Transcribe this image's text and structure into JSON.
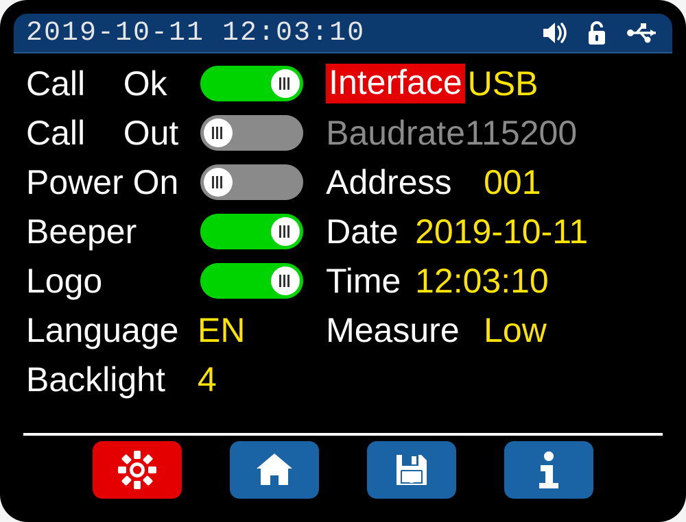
{
  "status": {
    "datetime": "2019-10-11 12:03:10"
  },
  "left": {
    "call_ok_label": "Call    Ok",
    "call_ok": true,
    "call_out_label": "Call    Out",
    "call_out": false,
    "power_on_label": "Power On",
    "power_on": false,
    "beeper_label": "Beeper",
    "beeper": true,
    "logo_label": "Logo",
    "logo": true,
    "language_label": "Language",
    "language_value": "EN",
    "backlight_label": "Backlight",
    "backlight_value": "4"
  },
  "right": {
    "interface_label": "Interface",
    "interface_value": "USB",
    "baudrate_label": "Baudrate",
    "baudrate_value": "115200",
    "address_label": "Address",
    "address_value": "001",
    "date_label": "Date",
    "date_value": "2019-10-11",
    "time_label": "Time",
    "time_value": "12:03:10",
    "measure_label": "Measure",
    "measure_value": "Low"
  },
  "nav": {
    "settings": "settings",
    "home": "home",
    "save": "save",
    "info": "info"
  },
  "colors": {
    "accent_yellow": "#ffe400",
    "toggle_on": "#00d400",
    "toggle_off": "#8a8a8a",
    "highlight": "#e40000",
    "nav_blue": "#1a64a6"
  }
}
